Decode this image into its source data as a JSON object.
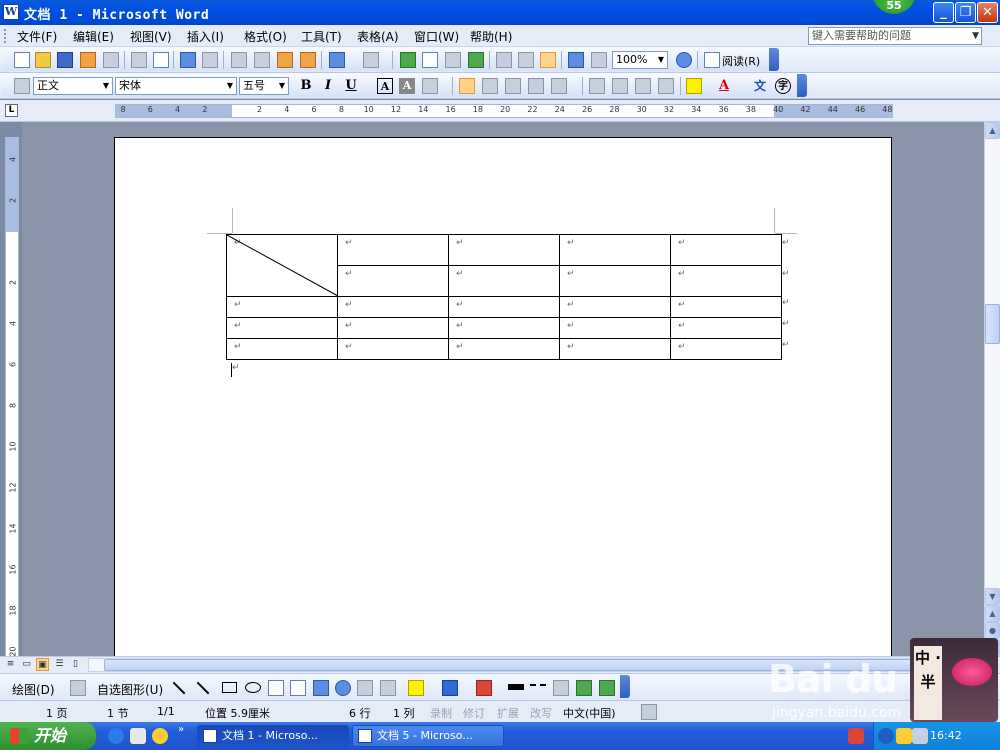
{
  "window": {
    "title": "文档 1 - Microsoft Word",
    "app_icon": "word-icon",
    "badge": "55",
    "controls": [
      "_",
      "❐",
      "✕"
    ]
  },
  "menu": {
    "items": [
      "文件(F)",
      "编辑(E)",
      "视图(V)",
      "插入(I)",
      "格式(O)",
      "工具(T)",
      "表格(A)",
      "窗口(W)",
      "帮助(H)"
    ],
    "help_placeholder": "键入需要帮助的问题"
  },
  "standard_toolbar": {
    "zoom": "100%",
    "read_label": "阅读(R)"
  },
  "format_toolbar": {
    "style": "正文",
    "font": "宋体",
    "size": "五号",
    "bold": "B",
    "italic": "I",
    "underline": "U",
    "charborder": "A",
    "charshade": "A",
    "font_color": "A",
    "phonetic": "文",
    "enclose": "字"
  },
  "ruler": {
    "ticks": [
      "8",
      "6",
      "4",
      "2",
      "2",
      "4",
      "6",
      "8",
      "10",
      "12",
      "14",
      "16",
      "18",
      "20",
      "22",
      "24",
      "26",
      "28",
      "30",
      "32",
      "34",
      "36",
      "38",
      "40",
      "42",
      "44",
      "46",
      "48"
    ],
    "vticks": [
      "4",
      "2",
      "2",
      "4",
      "6",
      "8",
      "10",
      "12",
      "14",
      "16",
      "18",
      "20"
    ]
  },
  "document": {
    "para_mark": "↵",
    "rows": 5,
    "cols": 5
  },
  "drawing_toolbar": {
    "draw_label": "绘图(D)",
    "autoshape_label": "自选图形(U)"
  },
  "status": {
    "page": "1 页",
    "section": "1 节",
    "page_of": "1/1",
    "position": "位置 5.9厘米",
    "line": "6 行",
    "column": "1 列",
    "rec": "录制",
    "trk": "修订",
    "ext": "扩展",
    "ovr": "改写",
    "language": "中文(中国)"
  },
  "taskbar": {
    "start": "开始",
    "tasks": [
      "文档 1 - Microso...",
      "文档 5 - Microso..."
    ],
    "clock": "16:42"
  },
  "watermark": {
    "logo": "Bai du 经验",
    "url": "jingyan.baidu.com",
    "sticker": "中 · 半"
  }
}
